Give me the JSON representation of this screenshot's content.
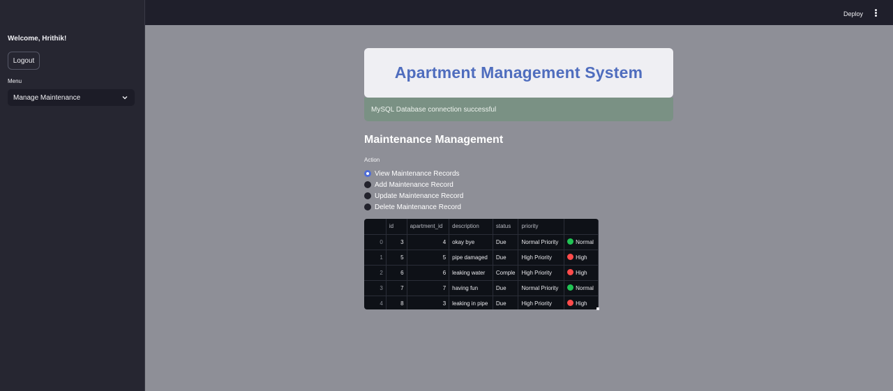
{
  "sidebar": {
    "welcome": "Welcome, Hrithik!",
    "logout_label": "Logout",
    "menu_label": "Menu",
    "menu_selected": "Manage Maintenance"
  },
  "topbar": {
    "deploy_label": "Deploy",
    "menu_icon": "kebab-menu-icon"
  },
  "header": {
    "title": "Apartment Management System",
    "status_message": "MySQL Database connection successful"
  },
  "main": {
    "section_title": "Maintenance Management",
    "action_label": "Action",
    "actions": [
      {
        "label": "View Maintenance Records",
        "selected": true
      },
      {
        "label": "Add Maintenance Record",
        "selected": false
      },
      {
        "label": "Update Maintenance Record",
        "selected": false
      },
      {
        "label": "Delete Maintenance Record",
        "selected": false
      }
    ]
  },
  "table": {
    "columns": [
      "",
      "id",
      "apartment_id",
      "description",
      "status",
      "priority",
      ""
    ],
    "rows": [
      {
        "index": "0",
        "id": "3",
        "apartment_id": "4",
        "description": "okay bye",
        "status": "Due",
        "priority": "Normal Priority",
        "level": "Normal",
        "level_color": "#21c354"
      },
      {
        "index": "1",
        "id": "5",
        "apartment_id": "5",
        "description": "pipe damaged",
        "status": "Due",
        "priority": "High Priority",
        "level": "High",
        "level_color": "#ff4b4b"
      },
      {
        "index": "2",
        "id": "6",
        "apartment_id": "6",
        "description": "leaking water",
        "status": "Comple",
        "priority": "High Priority",
        "level": "High",
        "level_color": "#ff4b4b"
      },
      {
        "index": "3",
        "id": "7",
        "apartment_id": "7",
        "description": "having fun",
        "status": "Due",
        "priority": "Normal Priority",
        "level": "Normal",
        "level_color": "#21c354"
      },
      {
        "index": "4",
        "id": "8",
        "apartment_id": "3",
        "description": "leaking in pipe",
        "status": "Due",
        "priority": "High Priority",
        "level": "High",
        "level_color": "#ff4b4b"
      }
    ]
  },
  "colors": {
    "accent": "#4f6dbe",
    "sidebar_bg": "#262631",
    "main_bg": "#8e8f97",
    "success_bg": "#7a9184"
  }
}
